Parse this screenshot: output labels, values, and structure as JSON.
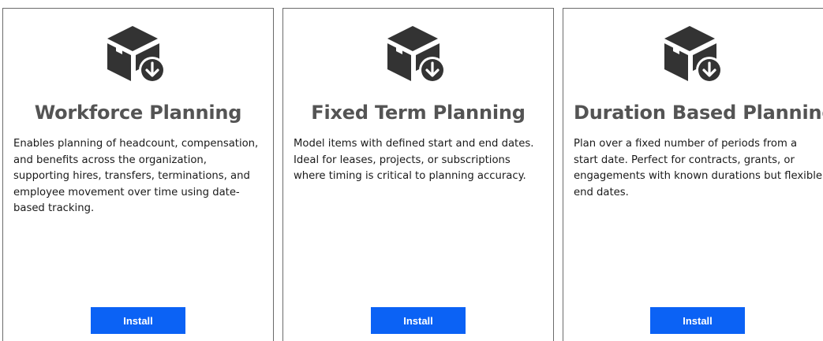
{
  "cards": [
    {
      "icon": "package-download-icon",
      "title": "Workforce Planning",
      "description": "Enables planning of headcount, compensation, and benefits across the organization, supporting hires, transfers, terminations, and employee movement over time using date-based tracking.",
      "button_label": "Install"
    },
    {
      "icon": "package-download-icon",
      "title": "Fixed Term Planning",
      "description": "Model items with defined start and end dates.  Ideal for leases, projects, or subscriptions where timing is critical to planning accuracy.",
      "button_label": "Install"
    },
    {
      "icon": "package-download-icon",
      "title": "Duration Based Planning",
      "description": "Plan over a fixed number of periods from a start date.  Perfect for contracts, grants, or engagements with known durations but flexible end dates.",
      "button_label": "Install"
    }
  ],
  "colors": {
    "accent": "#0b62f5",
    "icon": "#333333",
    "title": "#545454",
    "border": "#6b6b6b"
  }
}
